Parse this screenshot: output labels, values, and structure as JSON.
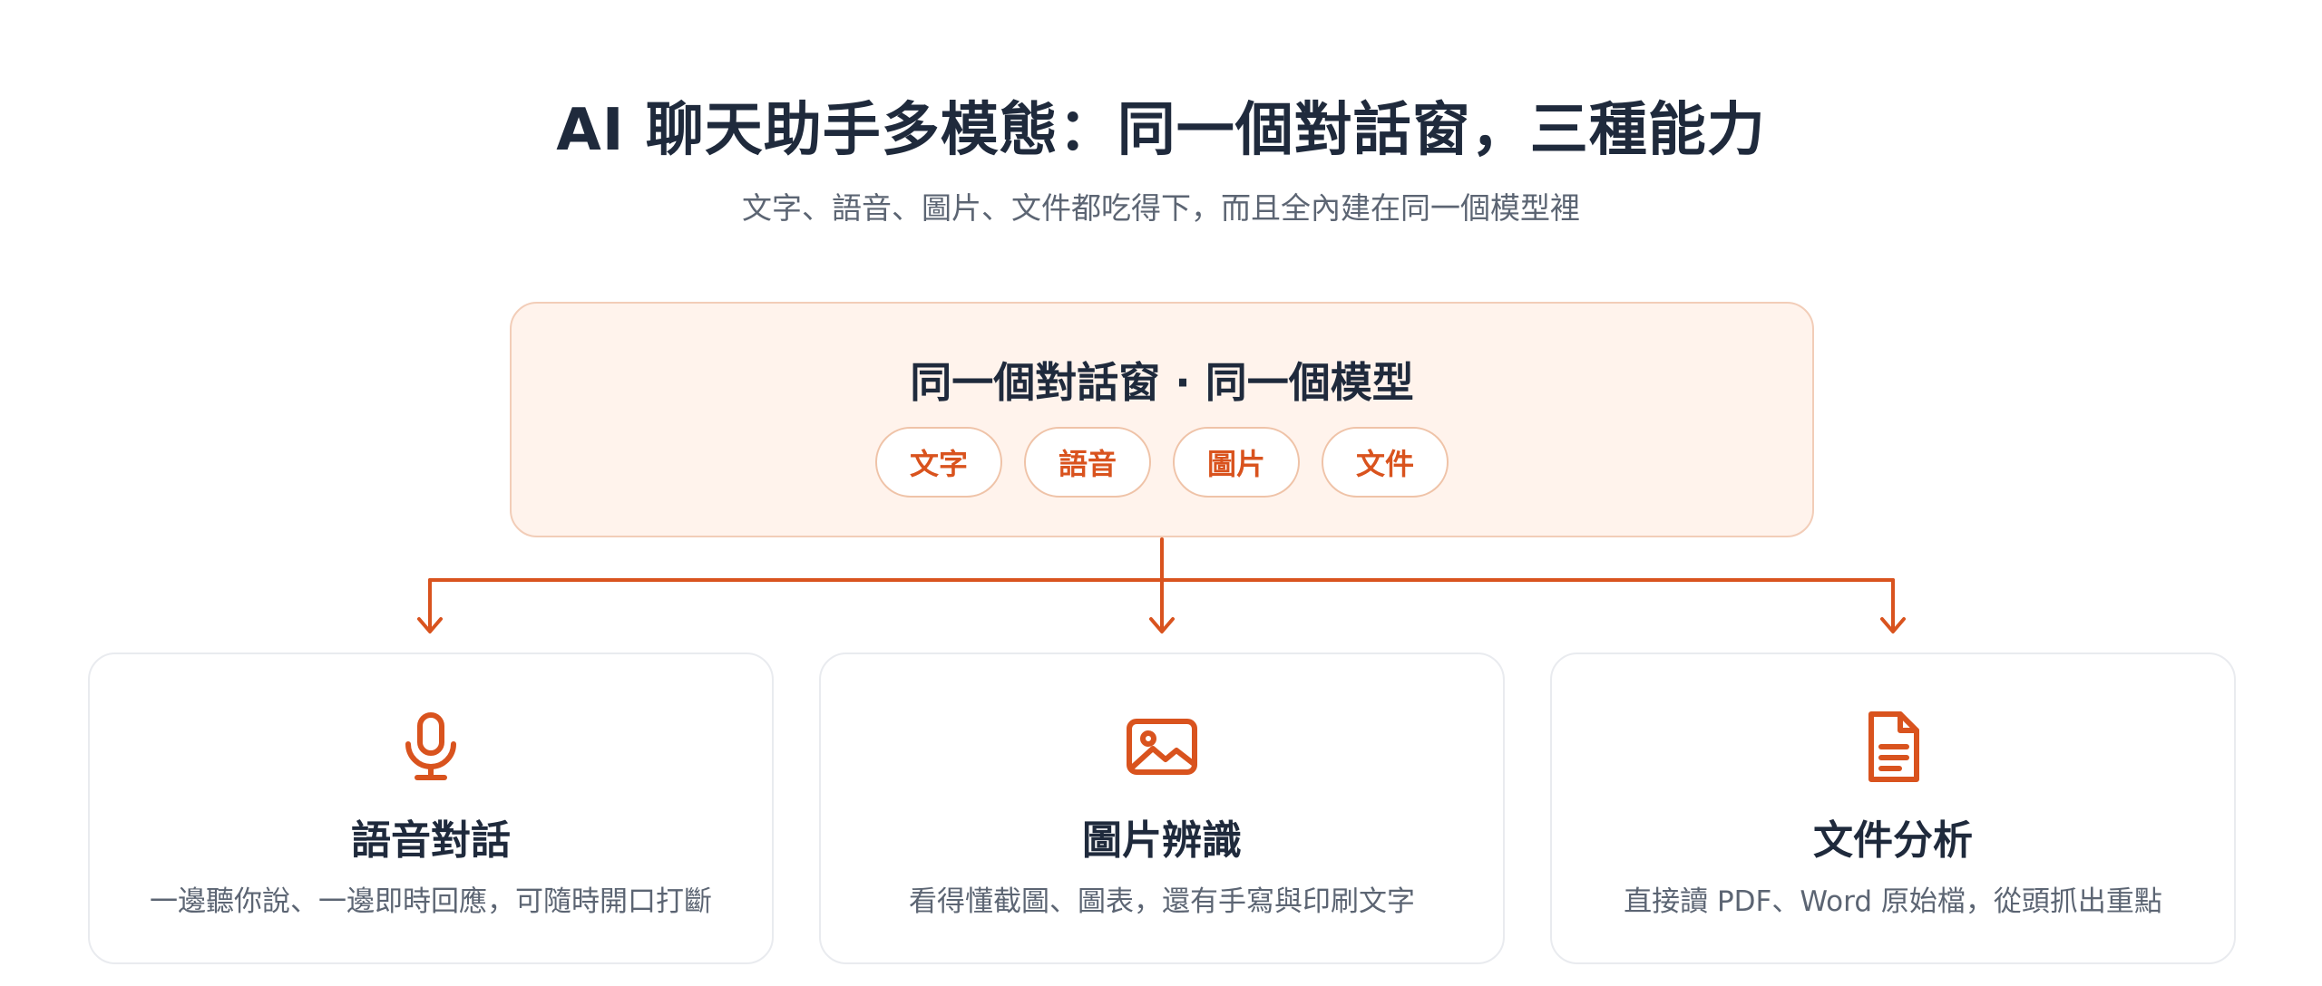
{
  "header": {
    "title": "AI 聊天助手多模態：同一個對話窗，三種能力",
    "subtitle": "文字、語音、圖片、文件都吃得下，而且全內建在同一個模型裡"
  },
  "hub": {
    "title": "同一個對話窗 · 同一個模型",
    "chips": [
      "文字",
      "語音",
      "圖片",
      "文件"
    ]
  },
  "cards": [
    {
      "icon": "microphone-icon",
      "title": "語音對話",
      "desc": "一邊聽你說、一邊即時回應，可隨時開口打斷"
    },
    {
      "icon": "image-icon",
      "title": "圖片辨識",
      "desc": "看得懂截圖、圖表，還有手寫與印刷文字"
    },
    {
      "icon": "document-icon",
      "title": "文件分析",
      "desc": "直接讀 PDF、Word 原始檔，從頭抓出重點"
    }
  ],
  "colors": {
    "accent": "#d9531e",
    "hub_bg": "#fff3ec",
    "heading": "#1f2a3c",
    "body_text": "#5c6573",
    "card_border": "#e9ebef"
  }
}
